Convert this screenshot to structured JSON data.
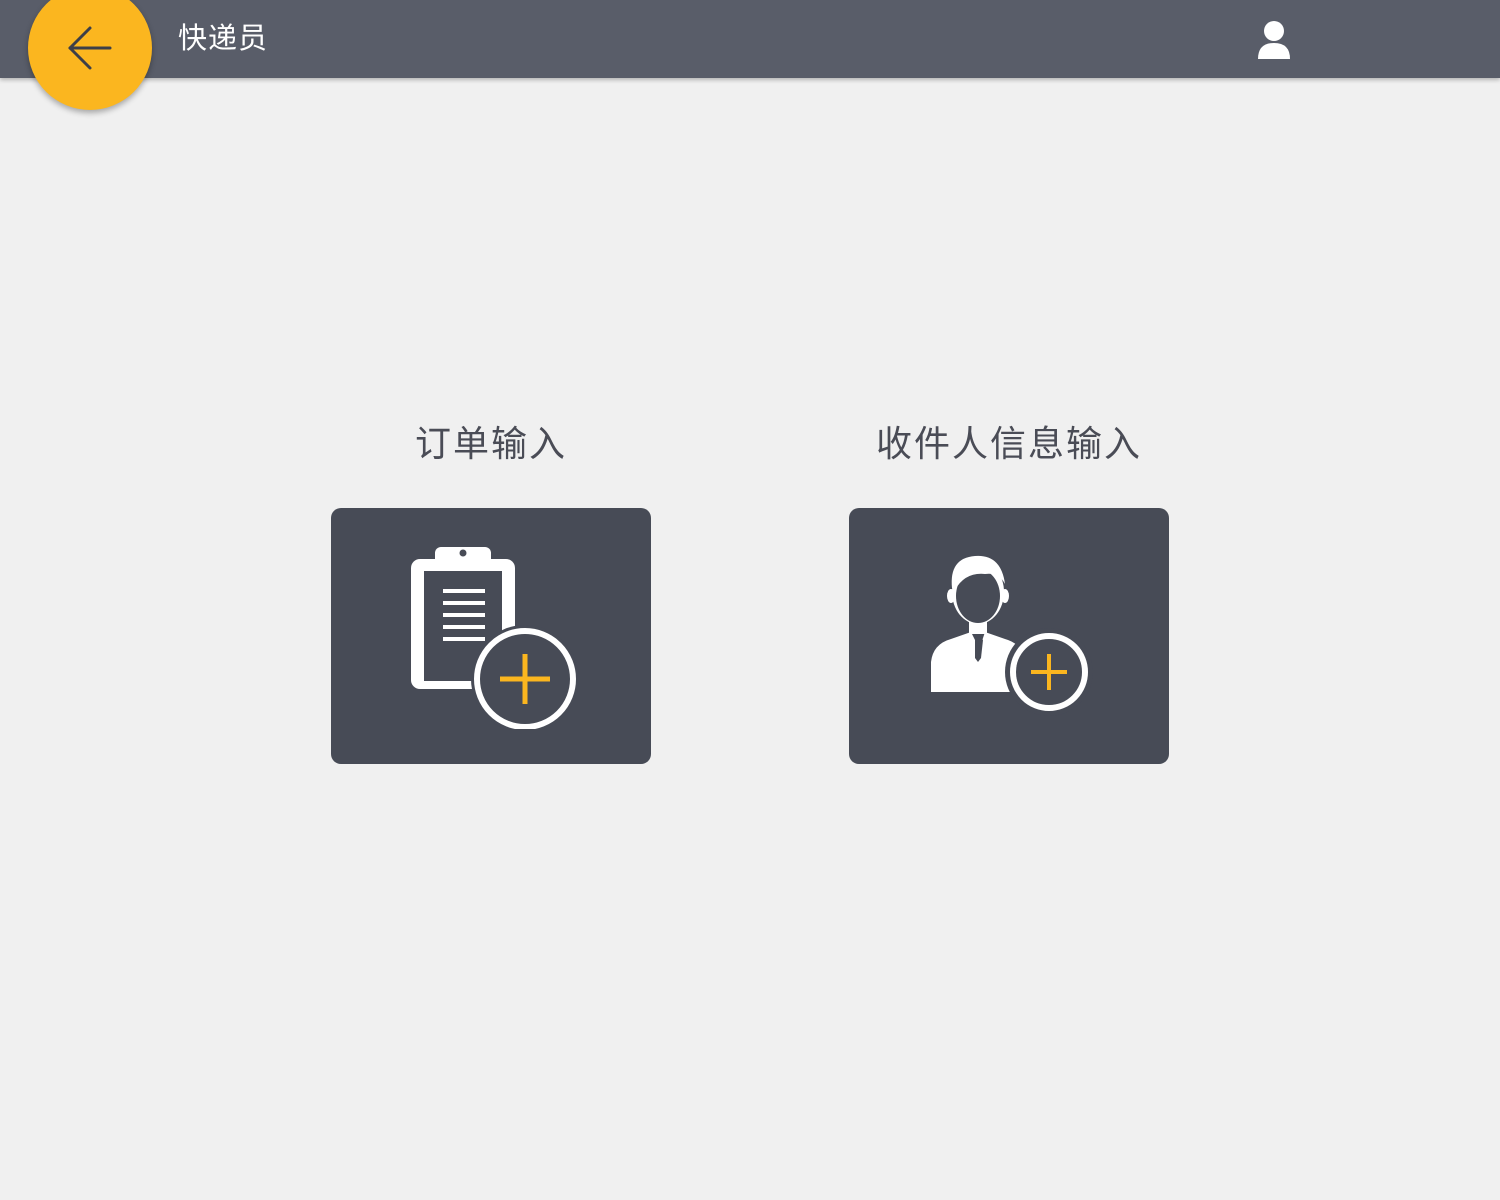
{
  "header": {
    "title": "快递员",
    "back_icon": "arrow-left-icon",
    "user_icon": "user-icon"
  },
  "tiles": [
    {
      "label": "订单输入",
      "icon": "clipboard-add-icon"
    },
    {
      "label": "收件人信息输入",
      "icon": "person-add-icon"
    }
  ],
  "colors": {
    "header_bg": "#595d69",
    "accent": "#fbb61f",
    "tile_bg": "#474b56",
    "page_bg": "#f0f0f0",
    "label_text": "#4a4c56"
  }
}
